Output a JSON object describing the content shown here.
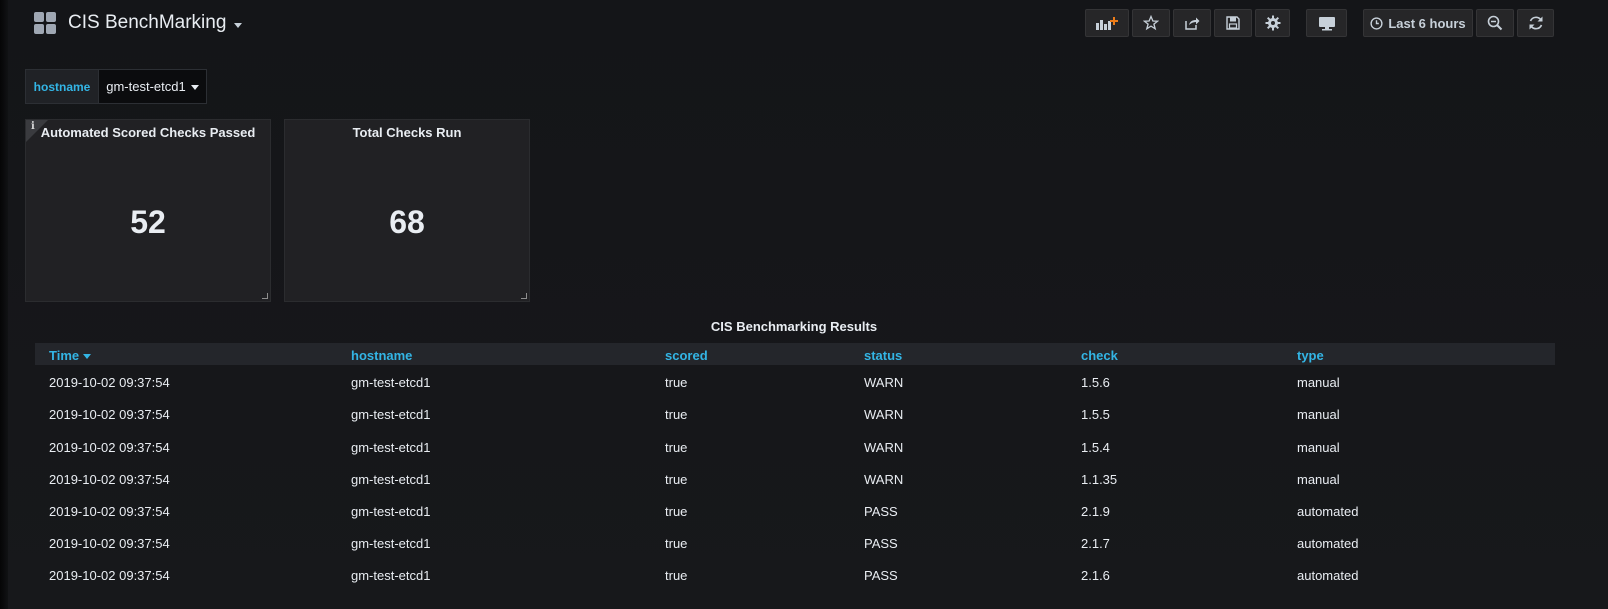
{
  "header": {
    "title": "CIS BenchMarking",
    "time_range": "Last 6 hours",
    "icons": [
      "add-panel-icon",
      "star-icon",
      "share-icon",
      "save-icon",
      "settings-icon",
      "tv-mode-icon",
      "clock-icon",
      "zoom-out-icon",
      "refresh-icon"
    ]
  },
  "variables": {
    "label": "hostname",
    "value": "gm-test-etcd1"
  },
  "panels": [
    {
      "title": "Automated Scored Checks Passed",
      "value": "52"
    },
    {
      "title": "Total Checks Run",
      "value": "68"
    }
  ],
  "table": {
    "title": "CIS Benchmarking Results",
    "columns": [
      "Time",
      "hostname",
      "scored",
      "status",
      "check",
      "type"
    ],
    "rows": [
      [
        "2019-10-02 09:37:54",
        "gm-test-etcd1",
        "true",
        "WARN",
        "1.5.6",
        "manual"
      ],
      [
        "2019-10-02 09:37:54",
        "gm-test-etcd1",
        "true",
        "WARN",
        "1.5.5",
        "manual"
      ],
      [
        "2019-10-02 09:37:54",
        "gm-test-etcd1",
        "true",
        "WARN",
        "1.5.4",
        "manual"
      ],
      [
        "2019-10-02 09:37:54",
        "gm-test-etcd1",
        "true",
        "WARN",
        "1.1.35",
        "manual"
      ],
      [
        "2019-10-02 09:37:54",
        "gm-test-etcd1",
        "true",
        "PASS",
        "2.1.9",
        "automated"
      ],
      [
        "2019-10-02 09:37:54",
        "gm-test-etcd1",
        "true",
        "PASS",
        "2.1.7",
        "automated"
      ],
      [
        "2019-10-02 09:37:54",
        "gm-test-etcd1",
        "true",
        "PASS",
        "2.1.6",
        "automated"
      ]
    ]
  },
  "colors": {
    "accent": "#33b5e5",
    "background": "#161719",
    "panel": "#212124"
  }
}
